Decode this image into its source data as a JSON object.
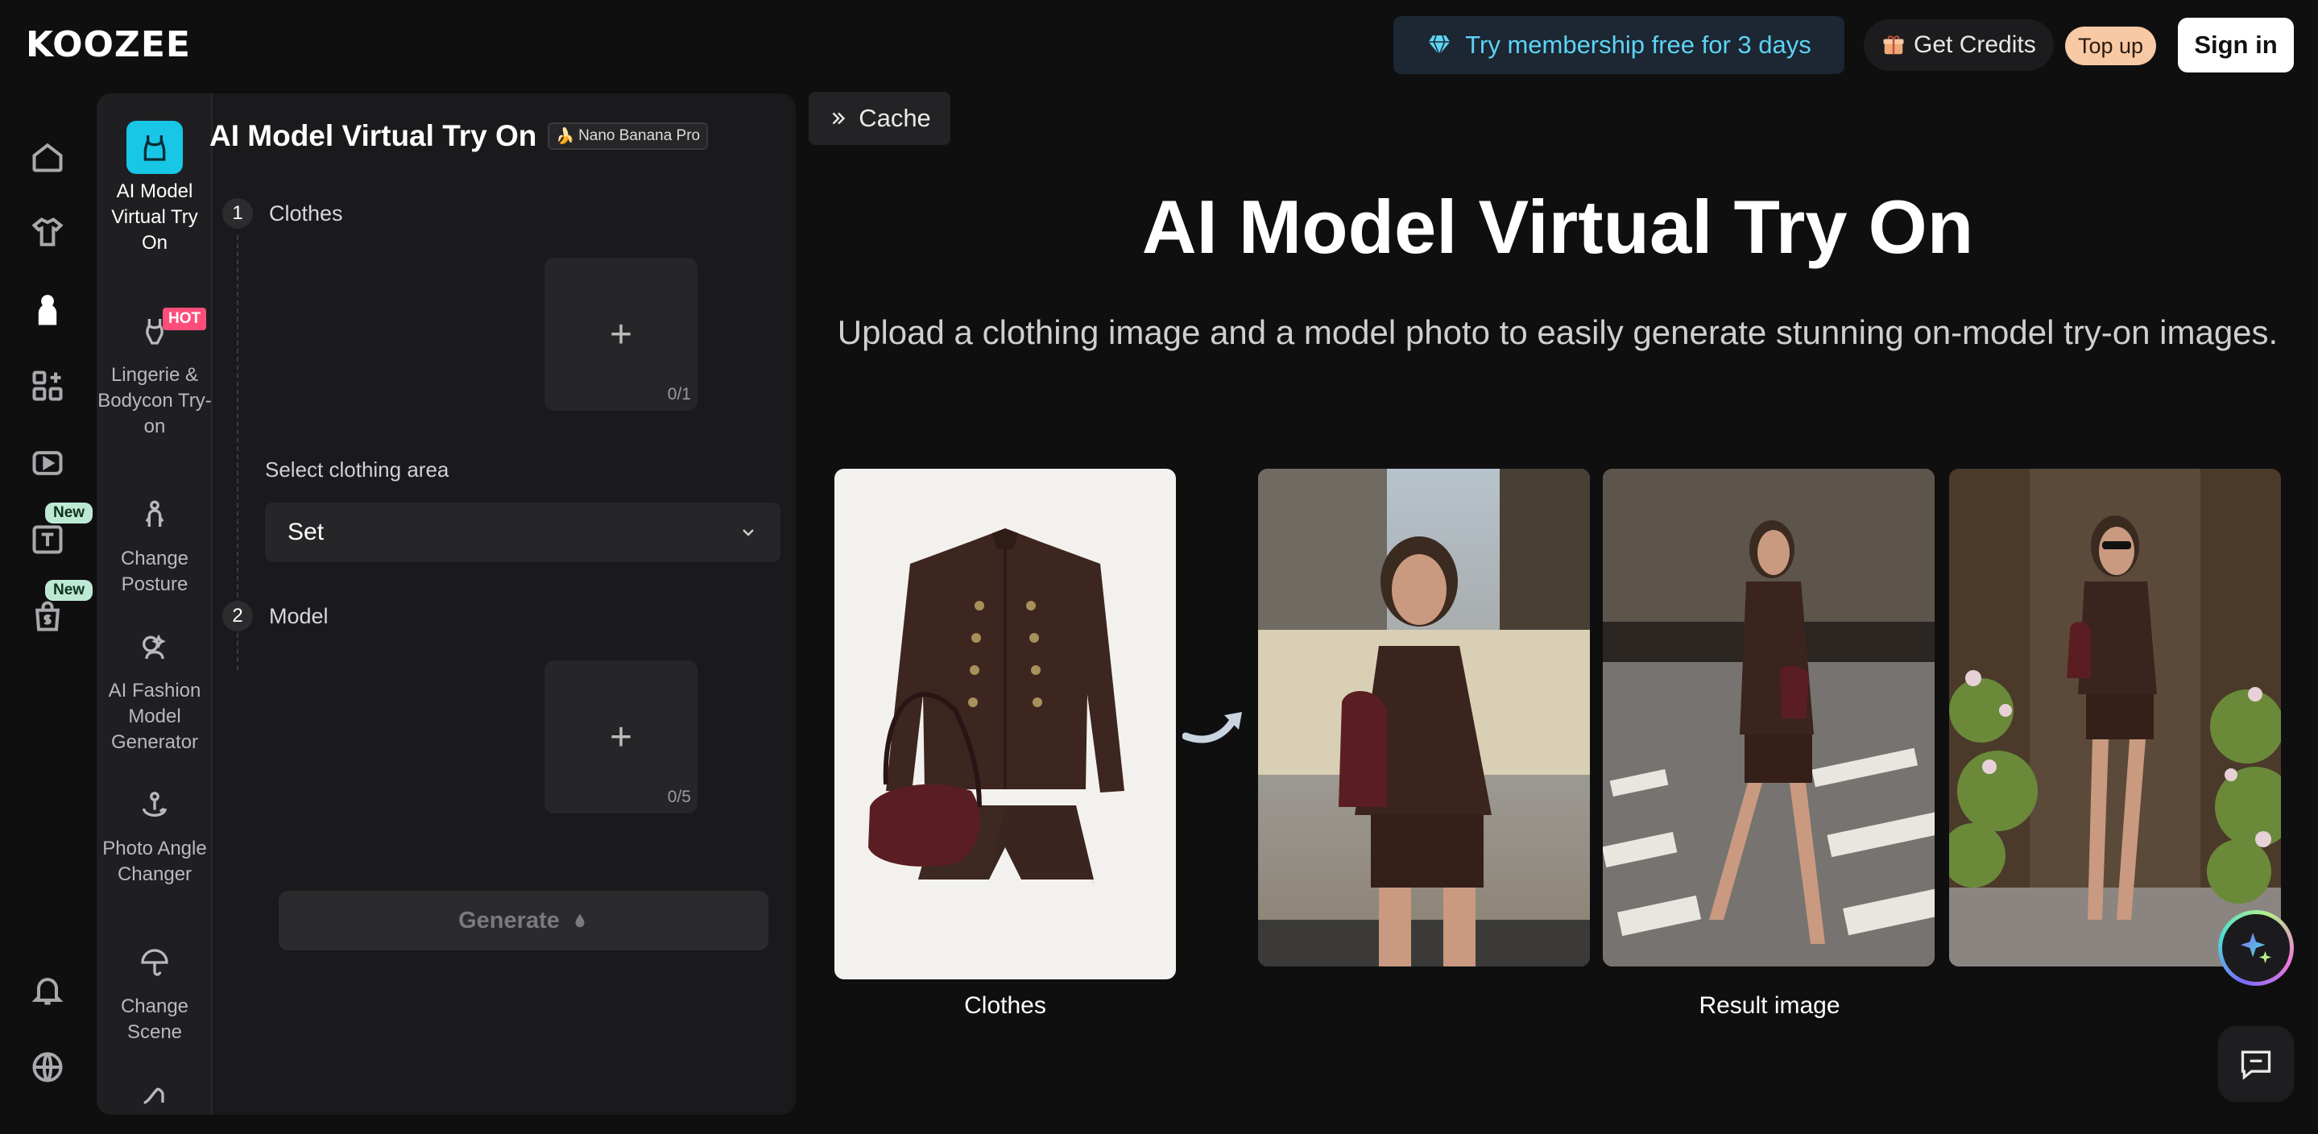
{
  "header": {
    "logo_text": "KOOZEE",
    "promo_label": "Try membership free for 3 days",
    "credits_label": "Get Credits",
    "topup_label": "Top up",
    "signin_label": "Sign in"
  },
  "rail": {
    "items": [
      {
        "icon": "home-icon"
      },
      {
        "icon": "shirt-icon"
      },
      {
        "icon": "model-icon",
        "active": true
      },
      {
        "icon": "apps-icon"
      },
      {
        "icon": "video-icon"
      },
      {
        "icon": "text-tool-icon",
        "badge": "New"
      },
      {
        "icon": "shop-bag-icon",
        "badge": "New"
      },
      {
        "icon": "bell-icon"
      },
      {
        "icon": "globe-icon"
      }
    ]
  },
  "tools": [
    {
      "label": "AI Model Virtual Try On",
      "active": true
    },
    {
      "label": "Lingerie & Bodycon Try-on",
      "badge": "HOT"
    },
    {
      "label": "Change Posture"
    },
    {
      "label": "AI Fashion Model Generator"
    },
    {
      "label": "Photo Angle Changer"
    },
    {
      "label": "Change Scene"
    }
  ],
  "form": {
    "title": "AI Model Virtual Try On",
    "badge": "Nano Banana Pro",
    "step1_label": "Clothes",
    "step1_num": "1",
    "step1_count": "0/1",
    "area_label": "Select clothing area",
    "area_value": "Set",
    "step2_label": "Model",
    "step2_num": "2",
    "step2_count": "0/5",
    "generate_label": "Generate"
  },
  "main": {
    "cache_label": "Cache",
    "title": "AI Model Virtual Try On",
    "subtitle": "Upload a clothing image and a model photo to easily generate stunning on-model try-on images.",
    "clothes_caption": "Clothes",
    "result_caption": "Result image"
  },
  "colors": {
    "accent": "#18c6e6",
    "promo_text": "#5cd4f4",
    "hot": "#ff4d7a",
    "new_badge": "#bde9d4",
    "topup": "#f7c9a4"
  }
}
